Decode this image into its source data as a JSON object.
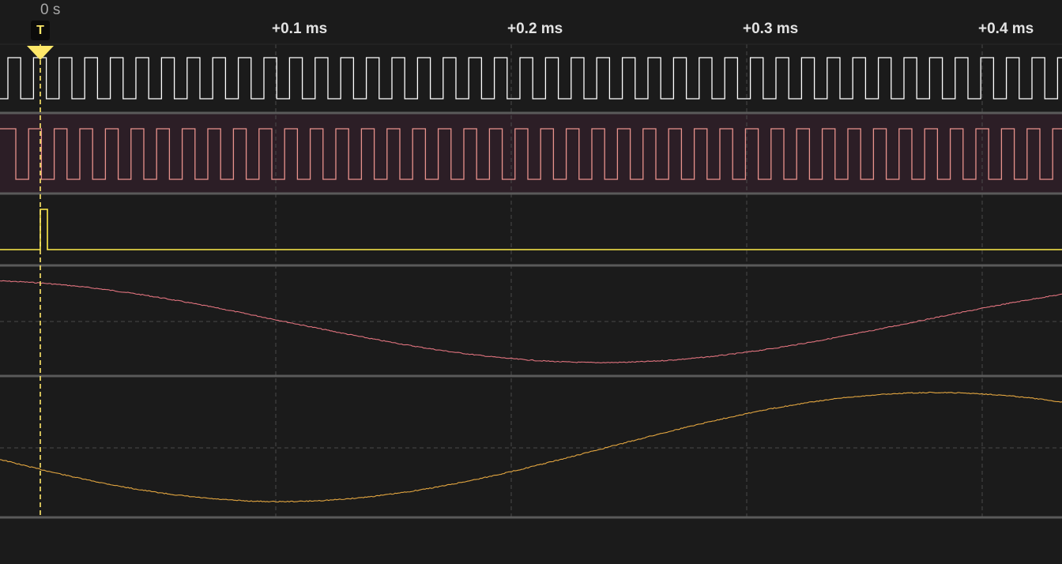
{
  "timeline": {
    "trigger_time_label": "0 s",
    "trigger_marker_label": "T",
    "ticks": [
      "+0.1 ms",
      "+0.2 ms",
      "+0.3 ms",
      "+0.4 ms"
    ]
  },
  "channels": [
    {
      "kind": "clock",
      "color": "#ffffff",
      "periods": 41.5
    },
    {
      "kind": "clock",
      "color": "#e8928c",
      "background": "#2c1e26",
      "selected": true,
      "periods": 41.5
    },
    {
      "kind": "pulse",
      "color": "#ffec4a"
    },
    {
      "kind": "analog",
      "color": "#e0737e",
      "waveform": "sine",
      "phase": "min near +0.23 ms"
    },
    {
      "kind": "analog",
      "color": "#e3a640",
      "waveform": "sine",
      "phase": "min near +0.08 ms"
    }
  ],
  "colors": {
    "background": "#1b1b1b",
    "grid": "#4a4a4a",
    "separator": "#5a5a5a",
    "trigger": "#ffe869"
  },
  "icons": {
    "trigger": "trigger-marker-icon"
  }
}
